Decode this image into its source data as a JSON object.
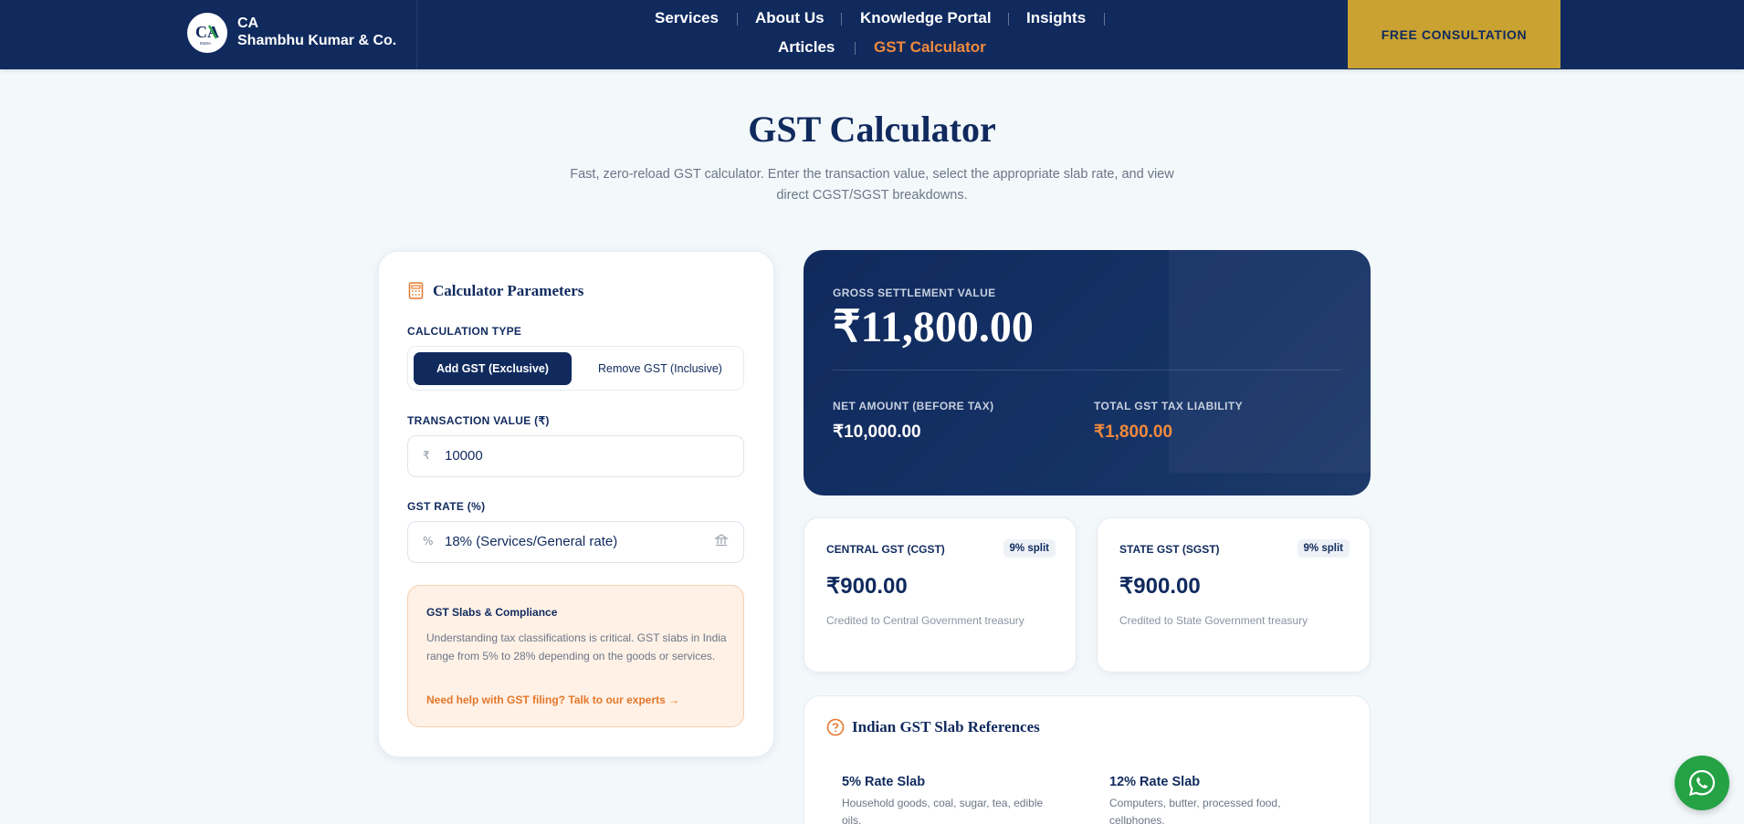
{
  "nav": {
    "brand_line1": "CA",
    "brand_line2": "Shambhu Kumar & Co.",
    "logo_text": "CA",
    "logo_sub": "INDIA",
    "links": [
      "Services",
      "About Us",
      "Knowledge Portal",
      "Insights",
      "Articles",
      "GST Calculator"
    ],
    "active_link": "GST Calculator",
    "cta_label": "FREE CONSULTATION"
  },
  "hero": {
    "title": "GST Calculator",
    "subtitle": "Fast, zero-reload GST calculator. Enter the transaction value, select the appropriate slab rate, and view direct CGST/SGST breakdowns."
  },
  "params": {
    "title": "Calculator Parameters",
    "calc_type_label": "CALCULATION TYPE",
    "toggle_on": "Add GST (Exclusive)",
    "toggle_off": "Remove GST (Inclusive)",
    "txn_label": "TRANSACTION VALUE (₹)",
    "txn_prefix": "₹",
    "txn_value": "10000",
    "rate_label": "GST RATE (%)",
    "rate_prefix": "%",
    "rate_value": "18% (Services/General rate)",
    "tip_title": "GST Slabs & Compliance",
    "tip_body": "Understanding tax classifications is critical. GST slabs in India range from 5% to 28% depending on the goods or services.",
    "tip_link": "Need help with GST filing? Talk to our experts →"
  },
  "result": {
    "gross_label": "GROSS SETTLEMENT VALUE",
    "gross_value": "₹11,800.00",
    "net_label": "NET AMOUNT (BEFORE TAX)",
    "net_value": "₹10,000.00",
    "tax_label": "TOTAL GST TAX LIABILITY",
    "tax_value": "₹1,800.00"
  },
  "cgst": {
    "label": "CENTRAL GST (CGST)",
    "badge": "9% split",
    "value": "₹900.00",
    "note": "Credited to Central Government treasury"
  },
  "sgst": {
    "label": "STATE GST (SGST)",
    "badge": "9% split",
    "value": "₹900.00",
    "note": "Credited to State Government treasury"
  },
  "slabs": {
    "title": "Indian GST Slab References",
    "items": [
      {
        "name": "5% Rate Slab",
        "desc": "Household goods, coal, sugar, tea, edible oils."
      },
      {
        "name": "12% Rate Slab",
        "desc": "Computers, butter, processed food, cellphones."
      }
    ]
  },
  "colors": {
    "navy": "#102a5e",
    "gold": "#c9a231",
    "orange": "#f08a3c",
    "whatsapp": "#25a244"
  },
  "icons": [
    "calculator-icon",
    "building-icon",
    "help-circle-icon",
    "whatsapp-icon"
  ]
}
